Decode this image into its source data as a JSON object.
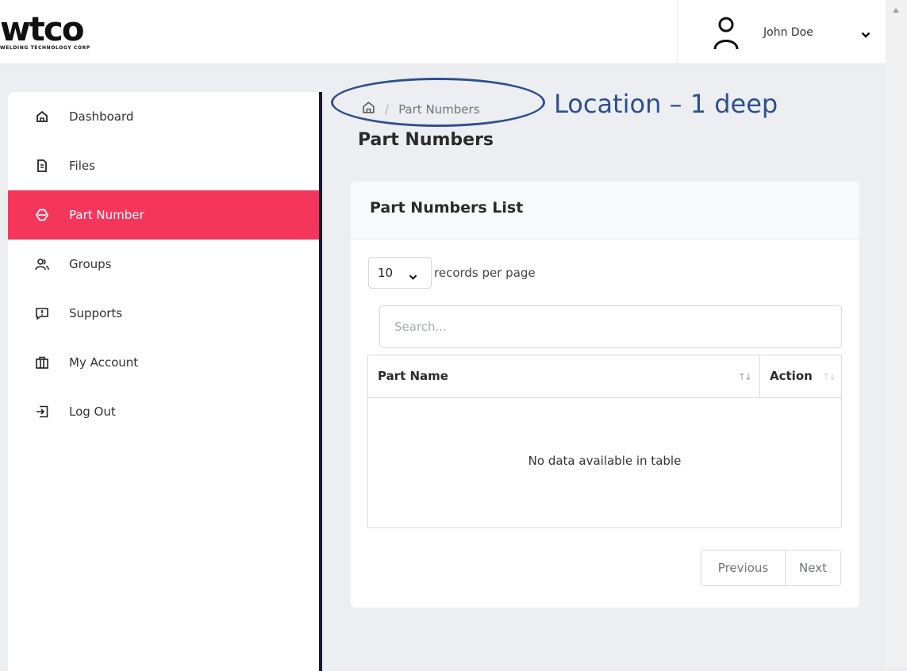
{
  "brand": {
    "logo_text": "wtco",
    "tagline": "WELDING TECHNOLOGY CORP"
  },
  "user": {
    "name": "John Doe"
  },
  "sidebar": {
    "items": [
      {
        "label": "Dashboard",
        "icon": "home-icon"
      },
      {
        "label": "Files",
        "icon": "file-icon"
      },
      {
        "label": "Part Number",
        "icon": "part-icon",
        "active": true
      },
      {
        "label": "Groups",
        "icon": "users-icon"
      },
      {
        "label": "Supports",
        "icon": "message-alert-icon"
      },
      {
        "label": "My Account",
        "icon": "briefcase-icon"
      },
      {
        "label": "Log Out",
        "icon": "logout-icon"
      }
    ]
  },
  "breadcrumb": {
    "current": "Part Numbers"
  },
  "annotation": {
    "text": "Location – 1 deep"
  },
  "page": {
    "title": "Part Numbers"
  },
  "card": {
    "title": "Part Numbers List",
    "page_length": "10",
    "page_length_label": "records per page",
    "search_placeholder": "Search...",
    "columns": [
      "Part Name",
      "Action"
    ],
    "empty_message": "No data available in table",
    "pagination": {
      "previous": "Previous",
      "next": "Next"
    }
  },
  "colors": {
    "accent": "#f5365c",
    "annotation": "#2e4f8f",
    "sidebar_border": "#1a1a2e"
  }
}
